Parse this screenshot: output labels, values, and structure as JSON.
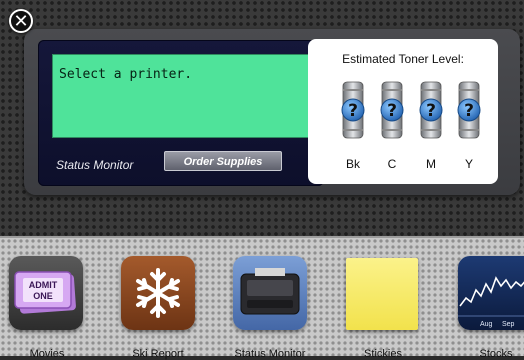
{
  "close_button": {
    "glyph": "✕"
  },
  "printer_widget": {
    "lcd_text": "Select a printer.",
    "status_label": "Status Monitor",
    "order_button_label": "Order Supplies",
    "toner": {
      "title": "Estimated Toner Level:",
      "cartridges": [
        {
          "label": "Bk",
          "level": "?"
        },
        {
          "label": "C",
          "level": "?"
        },
        {
          "label": "M",
          "level": "?"
        },
        {
          "label": "Y",
          "level": "?"
        }
      ]
    }
  },
  "dock": {
    "items": [
      {
        "label": "Movies",
        "icon": "admit-one-ticket-icon",
        "ticket_text_1": "ADMIT",
        "ticket_text_2": "ONE"
      },
      {
        "label": "Ski Report",
        "icon": "snowflake-icon"
      },
      {
        "label": "Status Monitor",
        "icon": "printer-icon"
      },
      {
        "label": "Stickies",
        "icon": "sticky-note-icon"
      },
      {
        "label": "Stocks",
        "icon": "stock-chart-icon",
        "axis_labels": [
          "Aug",
          "Sep"
        ]
      }
    ]
  },
  "colors": {
    "lcd_green": "#4fe39a",
    "panel_navy": "#15173a",
    "toner_bubble_blue": "#2a7fd0"
  }
}
